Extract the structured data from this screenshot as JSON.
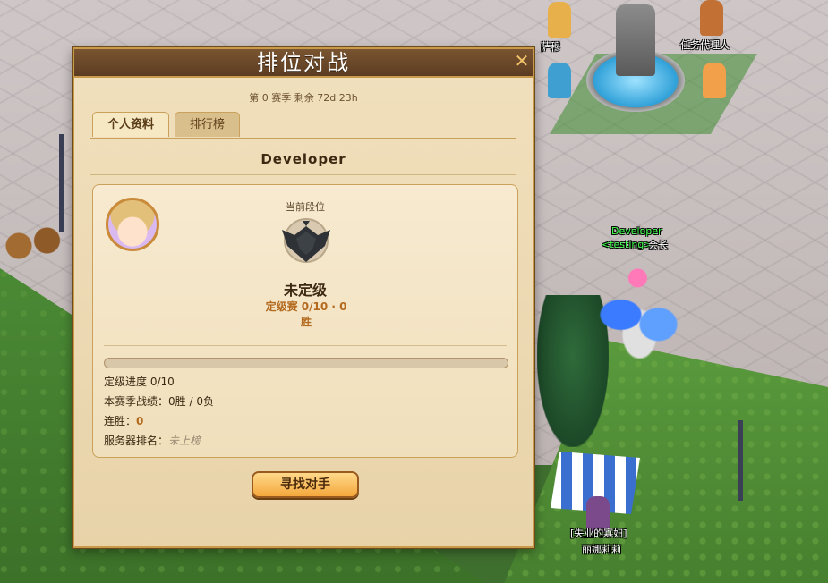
{
  "dialog": {
    "title": "排位对战",
    "season_text": "第 0 赛季 剩余 72d 23h",
    "close_icon": "close-icon",
    "tabs": [
      {
        "label": "个人资料",
        "active": true
      },
      {
        "label": "排行榜",
        "active": false
      }
    ],
    "player_name": "Developer",
    "rank_caption": "当前段位",
    "rank_icon": "rank-emblem-icon",
    "rank_name": "未定级",
    "placement_text": "定级赛 0/10 · 0",
    "placement_suffix": "胜",
    "progress_fraction": 0.0,
    "stats": {
      "placement_progress": "定级进度 0/10",
      "season_record_label": "本赛季战绩：",
      "season_record_value": "0胜 / 0负",
      "streak_label": "连胜：",
      "streak_value": "0",
      "server_rank_label": "服务器排名：",
      "server_rank_value": "未上榜"
    },
    "find_opponent_label": "寻找对手"
  },
  "world": {
    "labels": {
      "npc_top_left": "萨穆",
      "npc_agent": "任务代理人",
      "player_name": "Developer",
      "player_guild": "<testing>",
      "player_title": "会长",
      "merchant_title": "[失业的寡妇]",
      "merchant_name": "丽娜莉莉"
    }
  },
  "colors": {
    "titlebar": "#5c3c22",
    "panel": "#f1e0bd",
    "accent": "#b36a1f",
    "button": "#f4a73c"
  }
}
